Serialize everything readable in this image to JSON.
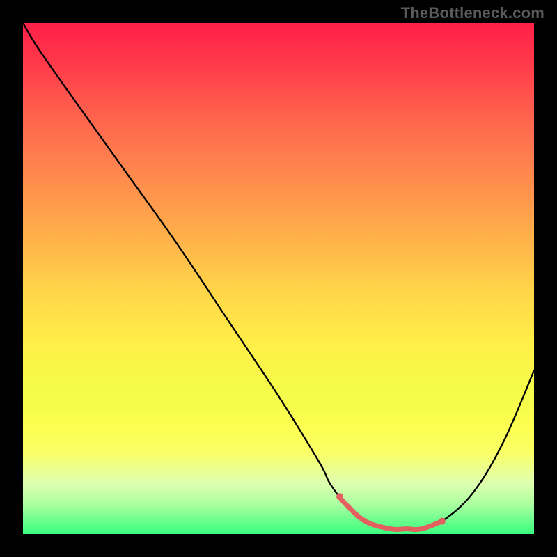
{
  "watermark": "TheBottleneck.com",
  "colors": {
    "background": "#000000",
    "curve": "#000000",
    "highlight": "#e26060",
    "gradient_top": "#ff1f47",
    "gradient_mid": "#ffd449",
    "gradient_bottom": "#38ff7e"
  },
  "chart_data": {
    "type": "line",
    "title": "",
    "xlabel": "",
    "ylabel": "",
    "xlim": [
      0,
      100
    ],
    "ylim": [
      0,
      100
    ],
    "grid": false,
    "legend": false,
    "x": [
      0,
      3,
      10,
      20,
      30,
      40,
      50,
      58,
      60,
      63,
      67,
      72,
      75,
      78,
      82,
      88,
      94,
      100
    ],
    "values": [
      100,
      95,
      85,
      71,
      57,
      42,
      27,
      14,
      10,
      6,
      2.5,
      1,
      1,
      1,
      2.5,
      8,
      18,
      32
    ],
    "highlight_range": {
      "x_start": 62,
      "x_end": 82
    },
    "annotations": []
  }
}
